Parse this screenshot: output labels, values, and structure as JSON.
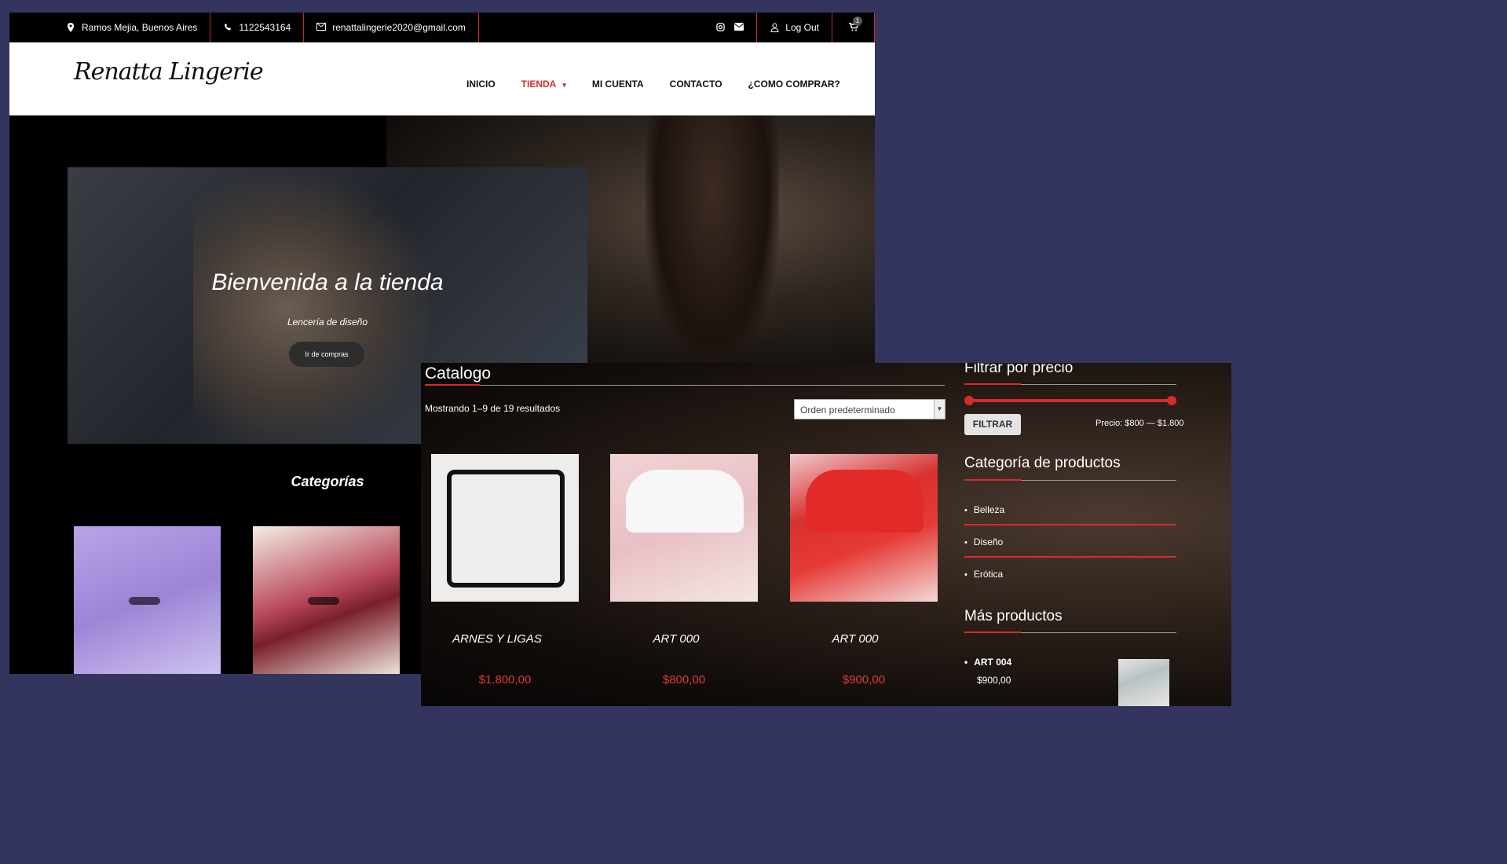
{
  "topbar": {
    "location": "Ramos Mejia, Buenos Aires",
    "phone": "1122543164",
    "email": "renattalingerie2020@gmail.com",
    "logout": "Log Out",
    "cart_count": "1"
  },
  "header": {
    "logo": "Renatta Lingerie",
    "nav": [
      "INICIO",
      "TIENDA",
      "MI CUENTA",
      "CONTACTO",
      "¿COMO COMPRAR?"
    ]
  },
  "hero": {
    "title": "Bienvenida a la tienda",
    "subtitle": "Lencería de diseño",
    "button": "Ir de compras"
  },
  "categories_title": "Categorías",
  "catalog": {
    "title": "Catalogo",
    "results": "Mostrando 1–9 de 19 resultados",
    "sort": "Orden predeterminado",
    "products": [
      {
        "name": "ARNES Y LIGAS",
        "price": "$1.800,00"
      },
      {
        "name": "ART 000",
        "price": "$800,00"
      },
      {
        "name": "ART 000",
        "price": "$900,00"
      }
    ]
  },
  "sidebar": {
    "filter_title": "Filtrar por precio",
    "filter_button": "FILTRAR",
    "price_label": "Precio: $800 — $1.800",
    "cat_title": "Categoría de productos",
    "categories": [
      "Belleza",
      "Diseño",
      "Erótica"
    ],
    "more_title": "Más productos",
    "more_product": {
      "name": "ART 004",
      "price": "$900,00"
    }
  },
  "colors": {
    "accent": "#d72b2b",
    "backdrop": "#33355e"
  }
}
